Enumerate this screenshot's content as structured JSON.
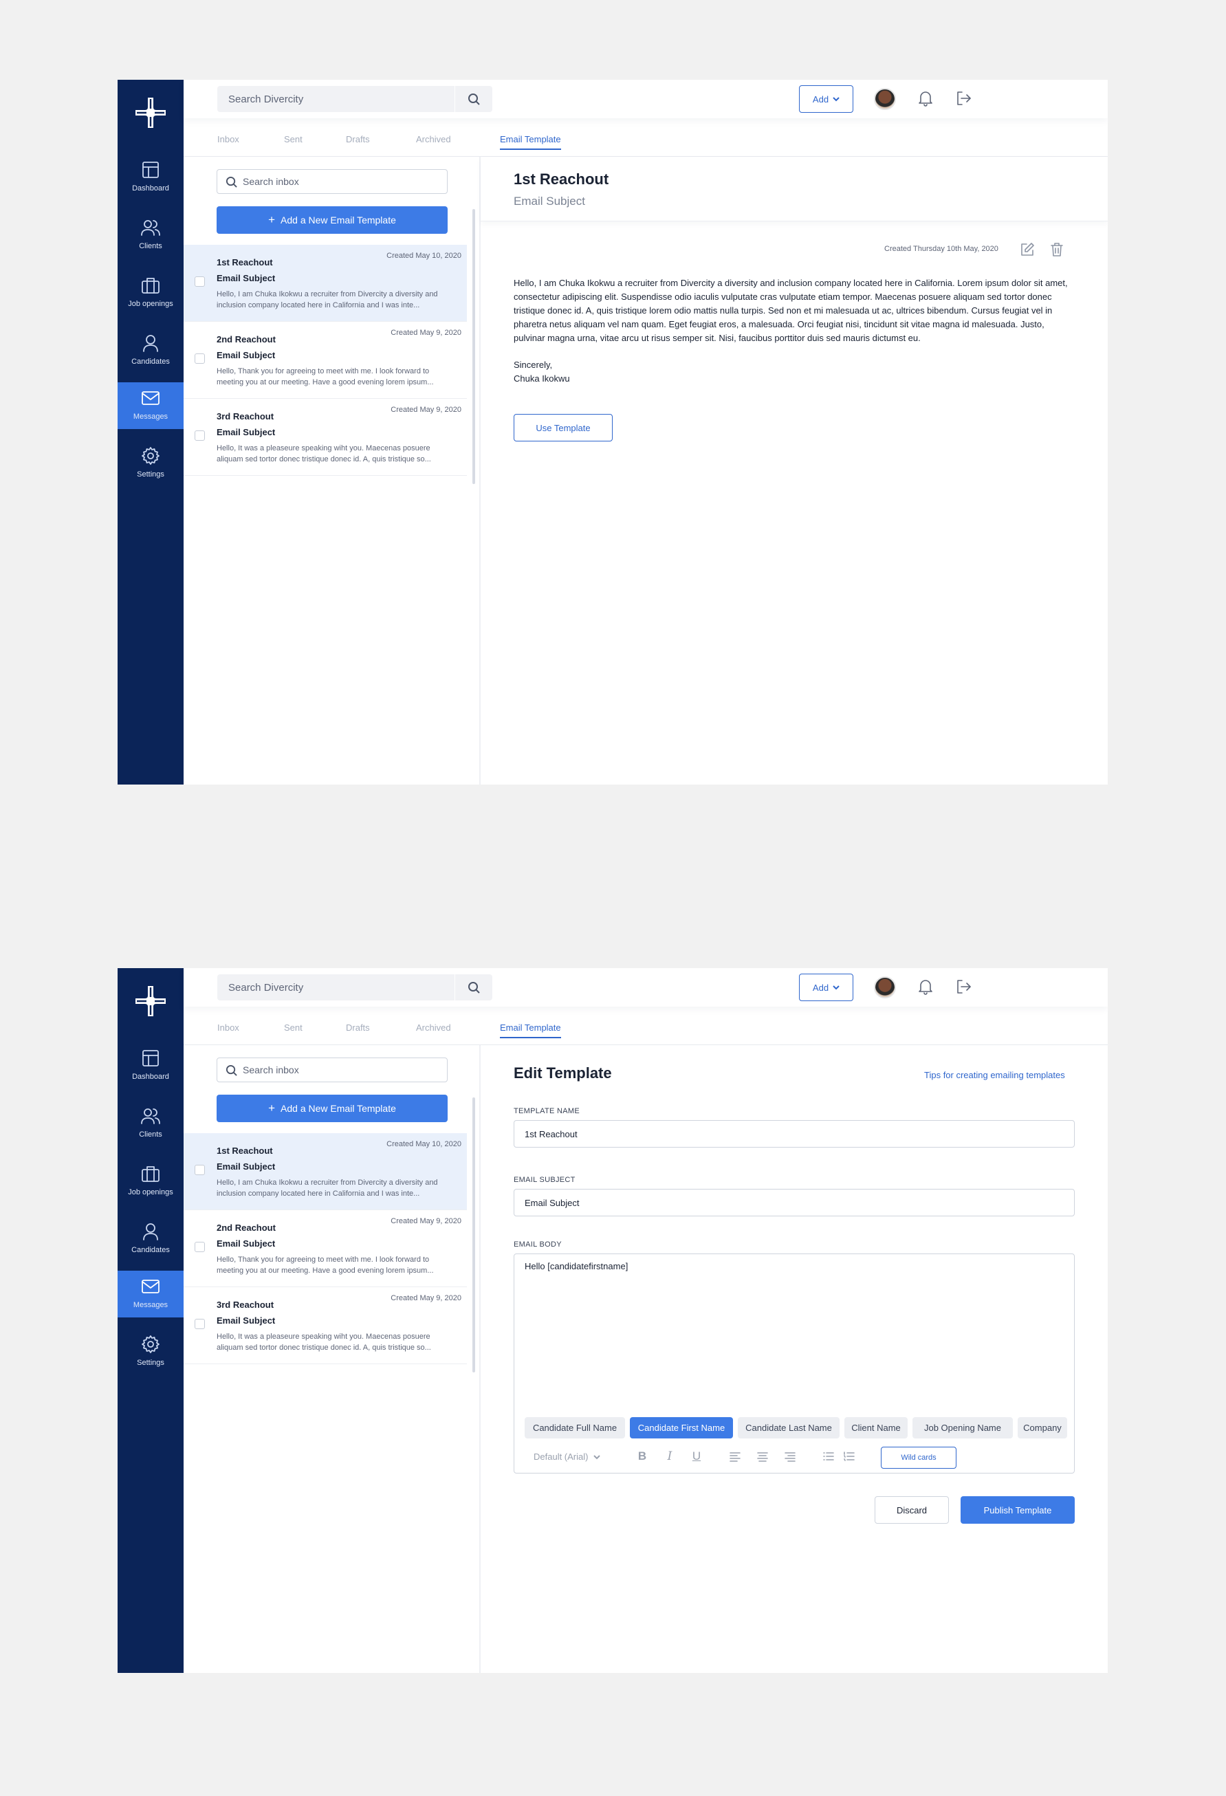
{
  "topbar": {
    "search_placeholder": "Search Divercity",
    "add_label": "Add"
  },
  "sidebar": {
    "items": [
      {
        "label": "Dashboard",
        "icon": "dashboard-icon"
      },
      {
        "label": "Clients",
        "icon": "clients-icon"
      },
      {
        "label": "Job openings",
        "icon": "briefcase-icon"
      },
      {
        "label": "Candidates",
        "icon": "user-icon"
      },
      {
        "label": "Messages",
        "icon": "mail-icon",
        "active": true
      },
      {
        "label": "Settings",
        "icon": "gear-icon"
      }
    ]
  },
  "tabs": [
    "Inbox",
    "Sent",
    "Drafts",
    "Archived",
    "Email Template"
  ],
  "list": {
    "search_placeholder": "Search inbox",
    "new_template_label": "Add a New Email Template",
    "messages": [
      {
        "date": "Created May 10, 2020",
        "title": "1st Reachout",
        "subject": "Email Subject",
        "preview": "Hello, I am Chuka Ikokwu a recruiter from Divercity a diversity and inclusion company located here in California and I was inte..."
      },
      {
        "date": "Created May 9, 2020",
        "title": "2nd Reachout",
        "subject": "Email Subject",
        "preview": "Hello, Thank you for agreeing to meet with me. I look forward to meeting you at our meeting. Have a good evening lorem ipsum..."
      },
      {
        "date": "Created May 9, 2020",
        "title": "3rd Reachout",
        "subject": "Email Subject",
        "preview": "Hello, It was a pleaseure speaking wiht you. Maecenas posuere aliquam sed tortor donec tristique donec id. A, quis tristique so..."
      }
    ]
  },
  "detail": {
    "title": "1st Reachout",
    "subject": "Email Subject",
    "meta": "Created Thursday 10th May, 2020",
    "body": "Hello, I am Chuka Ikokwu a recruiter from Divercity a diversity and inclusion company located here in California. Lorem ipsum dolor sit amet, consectetur adipiscing elit. Suspendisse odio iaculis vulputate cras vulputate etiam tempor. Maecenas posuere aliquam sed tortor donec tristique donec id. A, quis tristique lorem odio mattis nulla turpis. Sed non et mi malesuada ut ac, ultrices bibendum. Cursus feugiat vel in pharetra netus aliquam vel nam quam. Eget feugiat eros, a malesuada. Orci feugiat nisi, tincidunt sit vitae magna id malesuada. Justo, pulvinar magna urna, vitae arcu ut risus semper sit. Nisi, faucibus porttitor duis sed mauris dictumst eu.",
    "signoff": "Sincerely,",
    "signature": "Chuka Ikokwu",
    "use_label": "Use Template"
  },
  "edit": {
    "title": "Edit Template",
    "tips": "Tips for creating emailing templates",
    "name_label": "TEMPLATE NAME",
    "name_value": "1st Reachout",
    "subject_label": "EMAIL SUBJECT",
    "subject_value": "Email Subject",
    "body_label": "EMAIL BODY",
    "body_value": "Hello [candidatefirstname]",
    "chips": [
      "Candidate Full Name",
      "Candidate First Name",
      "Candidate Last Name",
      "Client Name",
      "Job Opening Name",
      "Company"
    ],
    "active_chip": "Candidate First Name",
    "font": "Default (Arial)",
    "bold": "B",
    "italic": "I",
    "underline": "U",
    "wildcards_label": "Wild cards",
    "discard_label": "Discard",
    "publish_label": "Publish Template"
  },
  "colors": {
    "sidebar": "#0b2458",
    "accent": "#3d7be6",
    "link": "#2f66cc"
  }
}
